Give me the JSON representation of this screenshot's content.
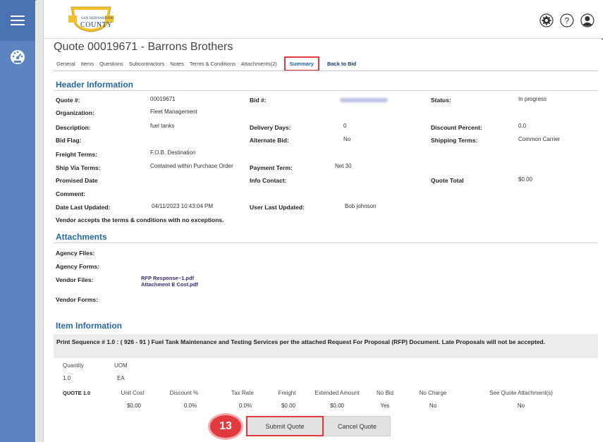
{
  "header": {
    "logo_line1": "SAN BERNARDINO",
    "logo_line2": "COUNTY"
  },
  "icons": {
    "menu": "hamburger-icon",
    "dashboard": "dashboard-icon",
    "settings": "gear-icon",
    "help": "help-icon",
    "user": "user-icon"
  },
  "page": {
    "title": "Quote 00019671 - Barrons Brothers"
  },
  "tabs": [
    {
      "label": "General"
    },
    {
      "label": "Items"
    },
    {
      "label": "Questions"
    },
    {
      "label": "Subcontractors"
    },
    {
      "label": "Notes"
    },
    {
      "label": "Terms & Conditions"
    },
    {
      "label": "Attachments(2)"
    },
    {
      "label": "Summary"
    },
    {
      "label": "Back to Bid"
    }
  ],
  "header_info": {
    "section_title": "Header Information",
    "quote_no_label": "Quote #:",
    "quote_no": "00019671",
    "bid_no_label": "Bid #:",
    "status_label": "Status:",
    "status": "In progress",
    "organization_label": "Organization:",
    "organization": "Fleet Management",
    "description_label": "Description:",
    "description": "fuel tanks",
    "delivery_days_label": "Delivery Days:",
    "delivery_days": "0",
    "discount_percent_label": "Discount Percent:",
    "discount_percent": "0.0",
    "bid_flag_label": "Bid Flag:",
    "alternate_bid_label": "Alternate Bid:",
    "alternate_bid": "No",
    "shipping_terms_label": "Shipping Terms:",
    "shipping_terms": "Common Carrier",
    "freight_terms_label": "Freight Terms:",
    "freight_terms": "F.O.B. Destination",
    "ship_via_label": "Ship Via Terms:",
    "ship_via": "Contained within Purchase Order",
    "payment_term_label": "Payment Term:",
    "payment_term": "Net 30",
    "promised_date_label": "Promised Date",
    "info_contact_label": "Info Contact:",
    "quote_total_label": "Quote Total",
    "quote_total": "$0.00",
    "comment_label": "Comment:",
    "date_updated_label": "Date Last Updated:",
    "date_updated": "04/11/2023 10:43:04 PM",
    "user_updated_label": "User Last Updated:",
    "user_updated": "Bob johnson",
    "acceptance": "Vendor accepts the terms & conditions with no exceptions."
  },
  "attachments": {
    "section_title": "Attachments",
    "agency_files_label": "Agency Files:",
    "agency_forms_label": "Agency Forms:",
    "vendor_files_label": "Vendor Files:",
    "vendor_file_1": "RFP Response~1.pdf",
    "vendor_file_2": "Attachment E Cost.pdf",
    "vendor_forms_label": "Vendor Forms:"
  },
  "item_info": {
    "section_title": "Item Information",
    "description": "Print Sequence # 1.0 :  ( 926  -  91 )  Fuel Tank Maintenance and Testing Services per the attached Request For Proposal (RFP) Document. Late Proposals will not be accepted.",
    "quantity_label": "Quantity",
    "uom_label": "UOM",
    "quantity": "1.0",
    "uom": "EA",
    "quote_label": "QUOTE 1.0",
    "columns": [
      "Unit Cost",
      "Discount %",
      "Tax Rate",
      "Freight",
      "Extended Amount",
      "No Bid",
      "No Charge",
      "See Quote Attachment(s)"
    ],
    "values": [
      "$0.00",
      "0.0%",
      "0.0%",
      "$0.00",
      "$0.00",
      "Yes",
      "No",
      "No"
    ]
  },
  "actions": {
    "step_badge": "13",
    "submit_label": "Submit Quote",
    "cancel_label": "Cancel Quote"
  },
  "colors": {
    "rail": "#5b84c0",
    "section_heading": "#2668a9",
    "highlight": "#e0393e"
  }
}
